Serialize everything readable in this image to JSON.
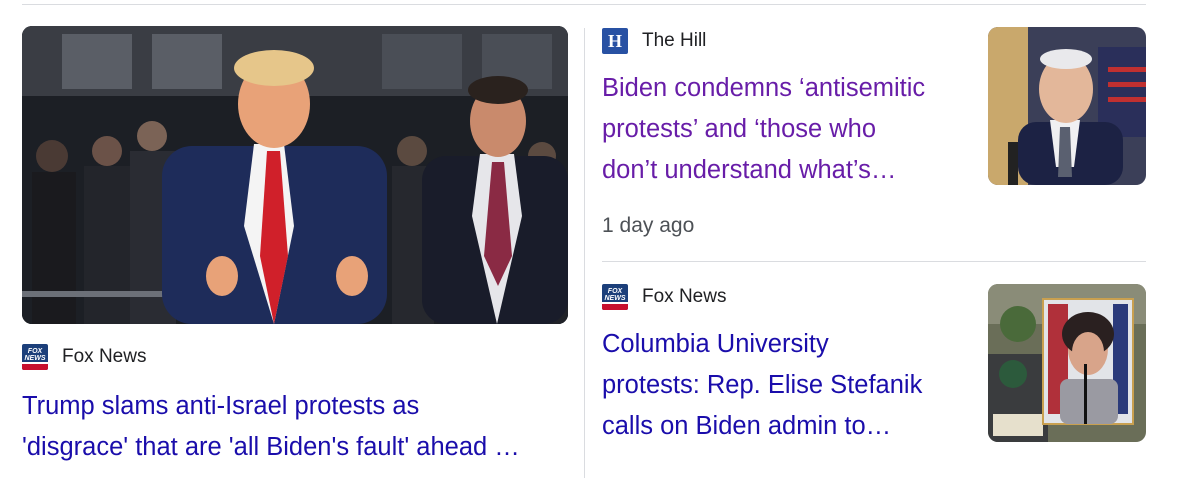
{
  "main_story": {
    "source": "Fox News",
    "source_icon": "fox-news-logo-icon",
    "headline_line1": "Trump slams anti-Israel protests as",
    "headline_line2": "'disgrace' that are 'all Biden's fault' ahead …"
  },
  "side_stories": [
    {
      "source": "The Hill",
      "source_icon": "the-hill-logo-icon",
      "logo_letter": "H",
      "headline_line1": "Biden condemns ‘antisemitic",
      "headline_line2": "protests’ and ‘those who",
      "headline_line3": "don’t understand what’s…",
      "time": "1 day ago",
      "visited": true
    },
    {
      "source": "Fox News",
      "source_icon": "fox-news-logo-icon",
      "headline_line1": "Columbia University",
      "headline_line2": "protests: Rep. Elise Stefanik",
      "headline_line3": "calls on Biden admin to…",
      "visited": false
    }
  ],
  "colors": {
    "link": "#1a0dab",
    "visited_link": "#681da8",
    "meta_text": "#4d5156",
    "divider": "#dadce0"
  }
}
